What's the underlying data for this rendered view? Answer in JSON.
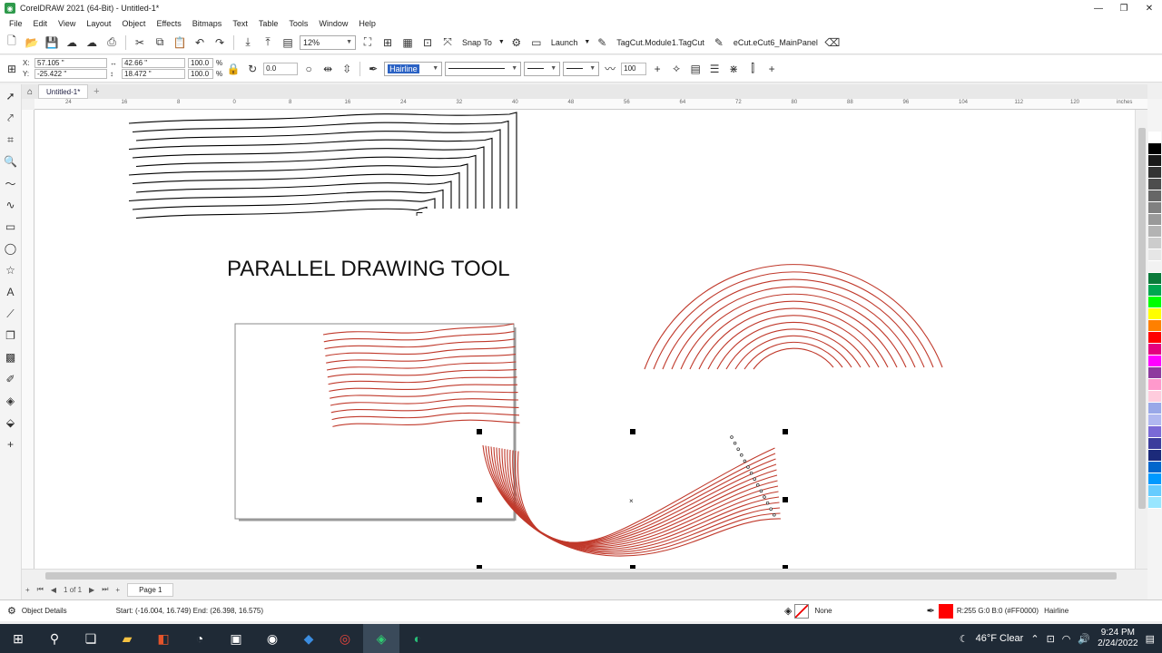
{
  "window": {
    "title": "CorelDRAW 2021 (64-Bit) - Untitled-1*",
    "controls": {
      "minimize": "—",
      "restore": "❐",
      "close": "✕"
    }
  },
  "menu": [
    "File",
    "Edit",
    "View",
    "Layout",
    "Object",
    "Effects",
    "Bitmaps",
    "Text",
    "Table",
    "Tools",
    "Window",
    "Help"
  ],
  "toolbar1": {
    "zoom_value": "12%",
    "snap_label": "Snap To",
    "launch_label": "Launch",
    "macro1_label": "TagCut.Module1.TagCut",
    "macro2_label": "eCut.eCut6_MainPanel"
  },
  "toolbar2": {
    "x_label": "X:",
    "x_value": "57.105 \"",
    "y_label": "Y:",
    "y_value": "-25.422 \"",
    "w_value": "42.66 \"",
    "h_value": "18.472 \"",
    "scale_x": "100.0",
    "scale_y": "100.0",
    "percent": "%",
    "rotation": "0.0",
    "outline_width": "Hairline",
    "smoothing_value": "100"
  },
  "doc_tab": {
    "label": "Untitled-1*"
  },
  "ruler": {
    "ticks": [
      "24",
      "16",
      "8",
      "0",
      "8",
      "16",
      "24",
      "32",
      "40",
      "48",
      "56",
      "64",
      "72",
      "80",
      "88",
      "96",
      "104",
      "112",
      "120"
    ],
    "unit": "inches"
  },
  "canvas": {
    "heading": "PARALLEL DRAWING TOOL",
    "stroke_black": "#000000",
    "stroke_red": "#c0392b"
  },
  "palette": [
    "#ffffff",
    "#000000",
    "#1a1a1a",
    "#333333",
    "#4d4d4d",
    "#666666",
    "#808080",
    "#999999",
    "#b3b3b3",
    "#cccccc",
    "#e6e6e6",
    "#f2f2f2",
    "#0a7a3a",
    "#00a650",
    "#00ff00",
    "#ffff00",
    "#ff8000",
    "#ff0000",
    "#e4007f",
    "#ff00ff",
    "#8e3a9e",
    "#ff99cc",
    "#ffccdd",
    "#99a8e8",
    "#b0b8f0",
    "#7a6ad6",
    "#3c3c9c",
    "#1c2a7a",
    "#0066cc",
    "#0099ff",
    "#66ccff",
    "#99e6ff"
  ],
  "pagebar": {
    "page_count": "1 of 1",
    "page_tab": "Page 1"
  },
  "status": {
    "object_details": "Object Details",
    "start_end": "Start: (-16.004, 16.749)  End: (26.398, 16.575)",
    "fill_label": "None",
    "outline_color_text": "R:255 G:0 B:0 (#FF0000)",
    "outline_width_text": "Hairline",
    "outline_color": "#ff0000"
  },
  "taskbar": {
    "weather": "46°F  Clear",
    "time": "9:24 PM",
    "date": "2/24/2022"
  }
}
